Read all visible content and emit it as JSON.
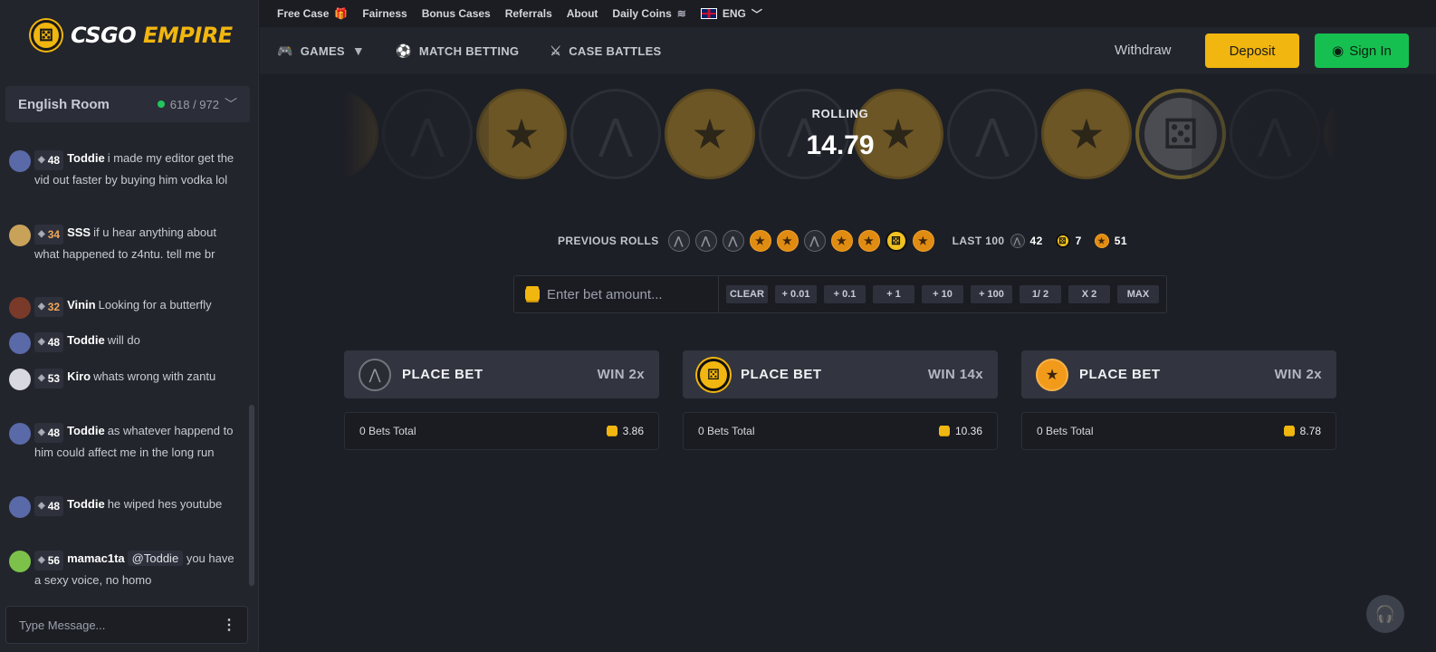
{
  "brand": {
    "name_part1": "CSGO",
    "name_part2": "EMPIRE"
  },
  "room": {
    "name": "English Room",
    "online": "618 / 972"
  },
  "chat": [
    {
      "level": "48",
      "name": "Toddie",
      "text": "i made my editor get the vid out faster by buying him vodka lol",
      "avatar_color": "#5a6aa8",
      "lvl_style": ""
    },
    {
      "level": "34",
      "name": "SSS",
      "text": "if u hear anything about what happened to z4ntu. tell me br",
      "avatar_color": "#c9a25a",
      "lvl_style": "orange"
    },
    {
      "level": "32",
      "name": "Vinin",
      "text": "Looking for a butterfly",
      "avatar_color": "#7a3a2a",
      "lvl_style": "orange"
    },
    {
      "level": "48",
      "name": "Toddie",
      "text": "will do",
      "avatar_color": "#5a6aa8",
      "lvl_style": ""
    },
    {
      "level": "53",
      "name": "Kiro",
      "text": "whats wrong with zantu",
      "avatar_color": "#d8d8e0",
      "lvl_style": ""
    },
    {
      "level": "48",
      "name": "Toddie",
      "text": "as whatever happend to him could affect me in the long run",
      "avatar_color": "#5a6aa8",
      "lvl_style": ""
    },
    {
      "level": "48",
      "name": "Toddie",
      "text": "he wiped hes youtube",
      "avatar_color": "#5a6aa8",
      "lvl_style": ""
    },
    {
      "level": "56",
      "name": "mamac1ta",
      "mention": "@Toddie",
      "text": "you have a sexy voice, no homo",
      "avatar_color": "#7cc24a",
      "lvl_style": ""
    }
  ],
  "chat_input": {
    "placeholder": "Type Message..."
  },
  "topbar": {
    "free_case": "Free Case",
    "fairness": "Fairness",
    "bonus_cases": "Bonus Cases",
    "referrals": "Referrals",
    "about": "About",
    "daily_coins": "Daily Coins",
    "language": "ENG"
  },
  "nav": {
    "games": "GAMES",
    "match_betting": "MATCH BETTING",
    "case_battles": "CASE BATTLES",
    "withdraw": "Withdraw",
    "deposit": "Deposit",
    "sign_in": "Sign In"
  },
  "roll": {
    "label": "ROLLING",
    "value": "14.79",
    "strip": [
      "t",
      "ct",
      "t",
      "ct",
      "t",
      "ct",
      "t",
      "ct",
      "t",
      "bonus",
      "ct",
      "t"
    ]
  },
  "previous": {
    "label": "PREVIOUS ROLLS",
    "rolls": [
      "ct",
      "ct",
      "ct",
      "t",
      "t",
      "ct",
      "t",
      "t",
      "bonus",
      "t"
    ],
    "last100_label": "LAST 100",
    "ct_count": "42",
    "bonus_count": "7",
    "t_count": "51"
  },
  "bet": {
    "placeholder": "Enter bet amount...",
    "buttons": [
      "CLEAR",
      "+ 0.01",
      "+ 0.1",
      "+ 1",
      "+ 10",
      "+ 100",
      "1/ 2",
      "X 2",
      "MAX"
    ]
  },
  "columns": [
    {
      "type": "ct",
      "label": "PLACE BET",
      "win": "WIN 2x",
      "bets_total": "0 Bets Total",
      "amount": "3.86"
    },
    {
      "type": "bonus",
      "label": "PLACE BET",
      "win": "WIN 14x",
      "bets_total": "0 Bets Total",
      "amount": "10.36"
    },
    {
      "type": "t",
      "label": "PLACE BET",
      "win": "WIN 2x",
      "bets_total": "0 Bets Total",
      "amount": "8.78"
    }
  ],
  "colors": {
    "accent": "#f1b60f",
    "signin": "#16c050",
    "background": "#1d1f26"
  }
}
